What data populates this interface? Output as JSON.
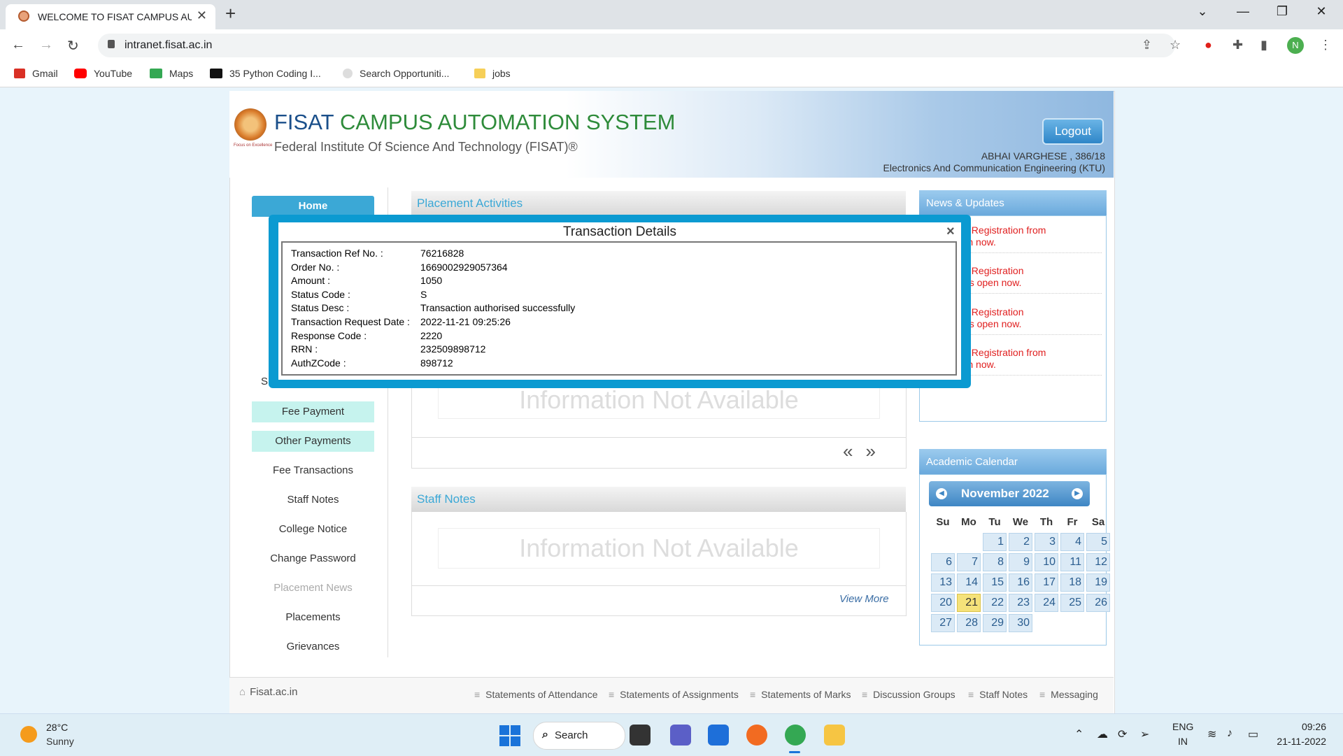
{
  "browser": {
    "tab_title": "WELCOME TO FISAT CAMPUS AU",
    "new_tab": "+",
    "url": "intranet.fisat.ac.in",
    "profile_initial": "N",
    "bookmarks": [
      "Gmail",
      "YouTube",
      "Maps",
      "35 Python Coding I...",
      "Search Opportuniti...",
      "jobs"
    ]
  },
  "header": {
    "title_part1": "FISAT",
    "title_part2": "CAMPUS AUTOMATION SYSTEM",
    "subtitle": "Federal Institute Of Science And Technology (FISAT)®",
    "logo_caption": "Focus on Excellence",
    "logout": "Logout",
    "user_name": "ABHAI VARGHESE , 386/18",
    "user_dept": "Electronics And Communication Engineering (KTU)"
  },
  "nav": {
    "home": "Home",
    "s_fragment": "S",
    "fee_payment": "Fee Payment",
    "other_payments": "Other Payments",
    "links": [
      "Fee Transactions",
      "Staff Notes",
      "College Notice",
      "Change Password",
      "Placement News",
      "Placements",
      "Grievances"
    ]
  },
  "main": {
    "placement_title": "Placement Activities",
    "placement_na": "Information Not Available",
    "arrows": "«»",
    "staff_title": "Staff Notes",
    "staff_na": "Information Not Available",
    "view_more": "View More"
  },
  "news": {
    "title": "News & Updates",
    "items": [
      {
        "l1": "Semester Registration from",
        "l2": "S2 is open now."
      },
      {
        "l1": "Semester Registration",
        "l2": "S1 to S2 is open now."
      },
      {
        "l1": "Semester Registration",
        "l2": "S1 to S2 is open now."
      },
      {
        "l1": "Semester Registration from",
        "l2": "S2 is open now."
      }
    ]
  },
  "calendar": {
    "title": "Academic Calendar",
    "month_label": "November  2022",
    "weekdays": [
      "Su",
      "Mo",
      "Tu",
      "We",
      "Th",
      "Fr",
      "Sa"
    ],
    "first_weekday_index": 2,
    "days_in_month": 30,
    "today": 21
  },
  "footer": {
    "site": "Fisat.ac.in",
    "links": [
      "Statements of Attendance",
      "Statements of Assignments",
      "Statements of Marks",
      "Discussion Groups",
      "Staff Notes",
      "Messaging"
    ]
  },
  "modal": {
    "title": "Transaction Details",
    "close": "×",
    "rows": [
      {
        "label": "Transaction Ref No. :",
        "value": "76216828"
      },
      {
        "label": "Order No. :",
        "value": "1669002929057364"
      },
      {
        "label": "Amount :",
        "value": "1050"
      },
      {
        "label": "Status Code :",
        "value": "S"
      },
      {
        "label": "Status Desc :",
        "value": "Transaction authorised successfully"
      },
      {
        "label": "Transaction Request Date :",
        "value": "2022-11-21 09:25:26"
      },
      {
        "label": "Response Code :",
        "value": "2220"
      },
      {
        "label": "RRN :",
        "value": "232509898712"
      },
      {
        "label": "AuthZCode :",
        "value": "898712"
      }
    ]
  },
  "taskbar": {
    "temp": "28°C",
    "weather": "Sunny",
    "search": "Search",
    "lang1": "ENG",
    "lang2": "IN",
    "time": "09:26",
    "date": "21-11-2022"
  }
}
